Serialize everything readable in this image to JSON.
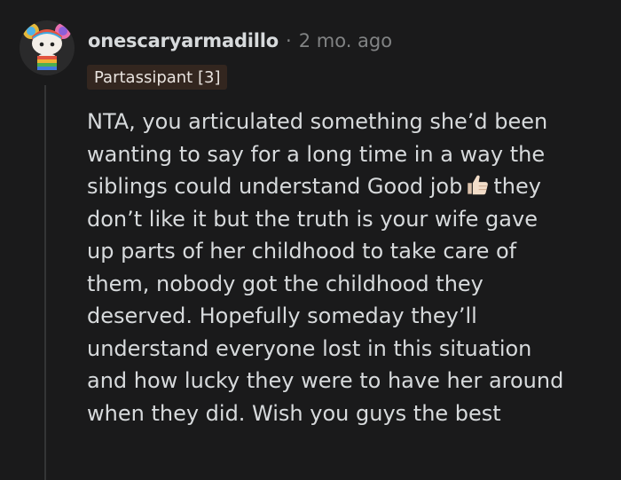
{
  "comment": {
    "username": "onescaryarmadillo",
    "separator": "·",
    "timestamp": "2 mo. ago",
    "flair": "Partassipant [3]",
    "avatar_icon": "snoo-avatar-rainbow-icon",
    "emoji_icon": "thumbs-up-light-skin-icon",
    "body_lines": [
      "NTA, you articulated something she’d been",
      "wanting to say for a long time in a way the",
      "siblings could understand Good job",
      "they",
      "don’t like it but the truth is your wife gave",
      "up parts of her childhood to take care of",
      "them, nobody got the childhood they",
      "deserved. Hopefully someday they’ll",
      "understand everyone lost in this situation",
      "and how lucky they were to have her around",
      "when they did. Wish you guys the best"
    ]
  },
  "colors": {
    "background": "#1a1a1b",
    "text": "#d7dadc",
    "meta": "#818384",
    "flair_bg": "#33261f",
    "thread_line": "#343536"
  }
}
